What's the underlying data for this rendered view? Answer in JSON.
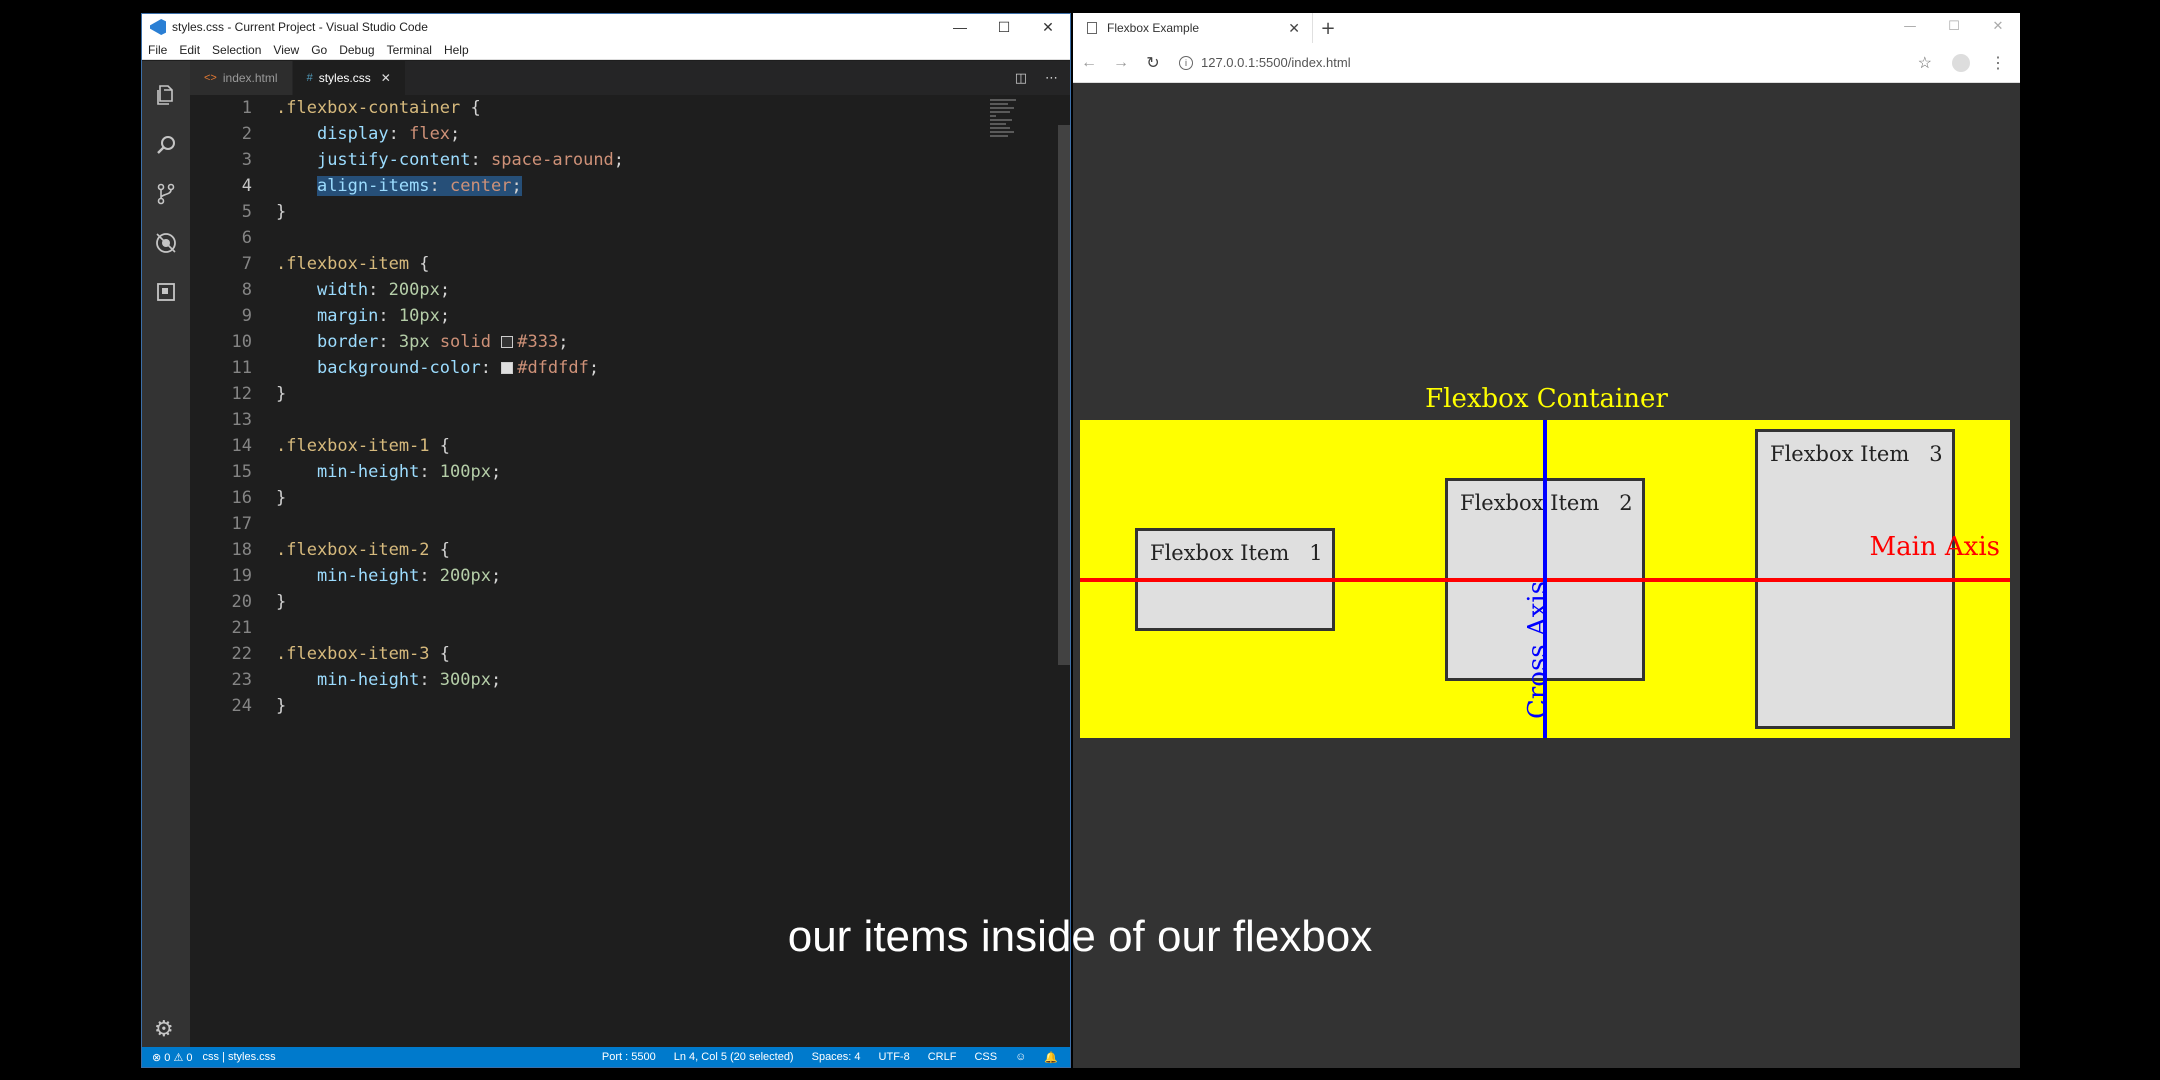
{
  "vscode": {
    "title": "styles.css - Current Project - Visual Studio Code",
    "menu": [
      "File",
      "Edit",
      "Selection",
      "View",
      "Go",
      "Debug",
      "Terminal",
      "Help"
    ],
    "tabs": [
      {
        "label": "index.html",
        "icon": "<>",
        "active": false
      },
      {
        "label": "styles.css",
        "icon": "#",
        "active": true
      }
    ],
    "activity_icons": [
      "files-icon",
      "search-icon",
      "source-control-icon",
      "debug-icon",
      "extensions-icon"
    ],
    "code_lines": [
      {
        "n": "1",
        "code": ".flexbox-container {"
      },
      {
        "n": "2",
        "code": "    display: flex;"
      },
      {
        "n": "3",
        "code": "    justify-content: space-around;"
      },
      {
        "n": "4",
        "code": "    align-items: center;"
      },
      {
        "n": "5",
        "code": "}"
      },
      {
        "n": "6",
        "code": ""
      },
      {
        "n": "7",
        "code": ".flexbox-item {"
      },
      {
        "n": "8",
        "code": "    width: 200px;"
      },
      {
        "n": "9",
        "code": "    margin: 10px;"
      },
      {
        "n": "10",
        "code": "    border: 3px solid #333;"
      },
      {
        "n": "11",
        "code": "    background-color: #dfdfdf;"
      },
      {
        "n": "12",
        "code": "}"
      },
      {
        "n": "13",
        "code": ""
      },
      {
        "n": "14",
        "code": ".flexbox-item-1 {"
      },
      {
        "n": "15",
        "code": "    min-height: 100px;"
      },
      {
        "n": "16",
        "code": "}"
      },
      {
        "n": "17",
        "code": ""
      },
      {
        "n": "18",
        "code": ".flexbox-item-2 {"
      },
      {
        "n": "19",
        "code": "    min-height: 200px;"
      },
      {
        "n": "20",
        "code": "}"
      },
      {
        "n": "21",
        "code": ""
      },
      {
        "n": "22",
        "code": ".flexbox-item-3 {"
      },
      {
        "n": "23",
        "code": "    min-height: 300px;"
      },
      {
        "n": "24",
        "code": "}"
      }
    ],
    "status": {
      "errors": "0",
      "warnings": "0",
      "path": "css | styles.css",
      "port": "Port : 5500",
      "position": "Ln 4, Col 5 (20 selected)",
      "spaces": "Spaces: 4",
      "encoding": "UTF-8",
      "eol": "CRLF",
      "language": "CSS"
    },
    "colors": {
      "accent": "#007acc",
      "selection": "#264f78"
    }
  },
  "browser": {
    "tab_title": "Flexbox Example",
    "url": "127.0.0.1:5500/index.html",
    "page": {
      "container_title": "Flexbox Container",
      "items": [
        "Flexbox Item   1",
        "Flexbox Item   2",
        "Flexbox Item   3"
      ],
      "main_axis_label": "Main Axis",
      "cross_axis_label": "Cross Axis",
      "colors": {
        "container": "#ffff00",
        "item": "#dfdfdf",
        "main_axis": "#ff0000",
        "cross_axis": "#0000ff"
      }
    }
  },
  "caption": "our items inside of our flexbox"
}
